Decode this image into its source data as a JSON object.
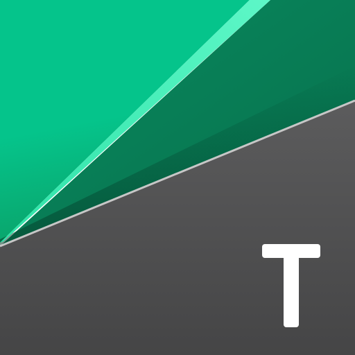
{
  "icon": {
    "letter": "T",
    "colors": {
      "green_bright": "#05c48b",
      "green_deep": "#0aa36a",
      "green_dark": "#087a55",
      "green_highlight": "#45f2bb",
      "gray_dark": "#4b4b4c",
      "gray_mid": "#5c5c5d",
      "divider_line": "#c7c7c7",
      "letter": "#ffffff"
    }
  }
}
